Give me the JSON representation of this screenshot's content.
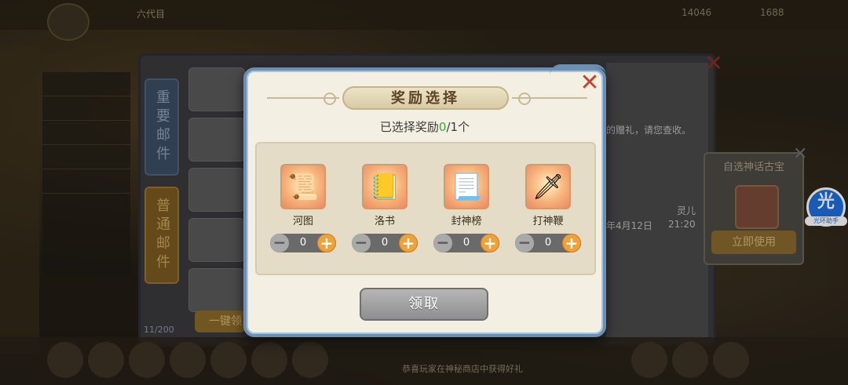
{
  "background": {
    "player_name": "六代目",
    "resource_1": "14046",
    "resource_2": "1688",
    "mail_tabs": [
      "重要邮件",
      "普通邮件"
    ],
    "mail_count": "11/200",
    "one_key_label": "一键领",
    "mail_text": "的赠礼，请您查收。",
    "mail_date": "年4月12日",
    "mail_sender": "灵儿",
    "mail_time": "21:20",
    "side_panel_title": "自选神话古宝",
    "side_panel_button": "立即使用",
    "helper_glyph": "光",
    "helper_label": "光环助手",
    "notice": "恭喜玩家在神秘商店中获得好礼"
  },
  "modal": {
    "title": "奖励选择",
    "selected_prefix": "已选择奖励",
    "selected_count": "0",
    "selected_total": "/1个",
    "rewards": [
      {
        "name": "河图",
        "glyph": "📜",
        "quantity": "0"
      },
      {
        "name": "洛书",
        "glyph": "📒",
        "quantity": "0"
      },
      {
        "name": "封神榜",
        "glyph": "📃",
        "quantity": "0"
      },
      {
        "name": "打神鞭",
        "glyph": "🗡",
        "quantity": "0"
      }
    ],
    "minus_symbol": "−",
    "plus_symbol": "+",
    "claim_label": "领取",
    "close_symbol": "✕"
  },
  "colors": {
    "modal_border": "#6c8fb3",
    "selected_count": "#3aa83a",
    "plus_button": "#f0a23a",
    "close_button": "#c8432a"
  }
}
